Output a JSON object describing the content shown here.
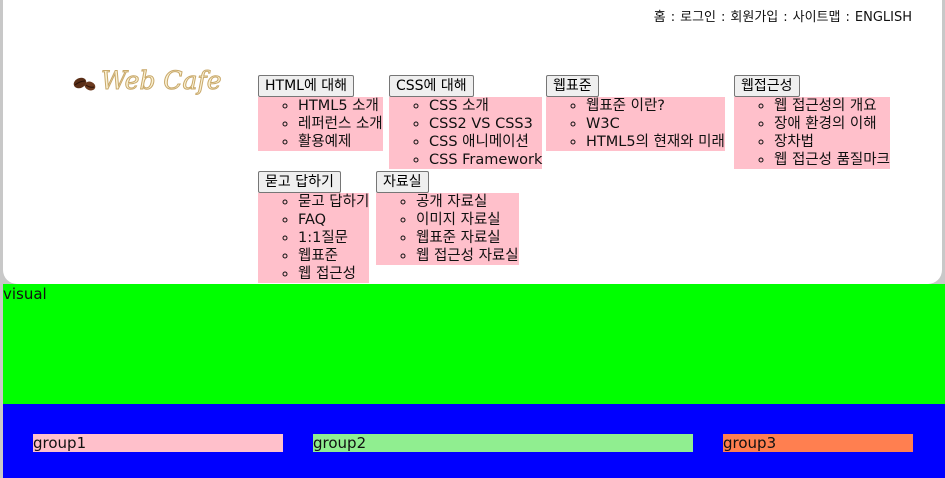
{
  "util_nav": {
    "items": [
      "홈",
      "로그인",
      "회원가입",
      "사이트맵",
      "ENGLISH"
    ],
    "separator": ":"
  },
  "logo": {
    "text": "Web Cafe",
    "icon": "coffee-beans-icon",
    "colors": {
      "bean": "#5a2e17",
      "text_fill": "#fbf2d4",
      "text_outline": "#c8a86a"
    }
  },
  "menus": [
    {
      "label": "HTML에 대해",
      "items": [
        "HTML5 소개",
        "레퍼런스 소개",
        "활용예제"
      ]
    },
    {
      "label": "CSS에 대해",
      "items": [
        "CSS 소개",
        "CSS2 VS CSS3",
        "CSS 애니메이션",
        "CSS Framework"
      ]
    },
    {
      "label": "웹표준",
      "items": [
        "웹표준 이란?",
        "W3C",
        "HTML5의 현재와 미래"
      ]
    },
    {
      "label": "웹접근성",
      "items": [
        "웹 접근성의 개요",
        "장애 환경의 이해",
        "장차법",
        "웹 접근성 품질마크"
      ]
    },
    {
      "label": "묻고 답하기",
      "items": [
        "묻고 답하기",
        "FAQ",
        "1:1질문",
        "웹표준",
        "웹 접근성"
      ]
    },
    {
      "label": "자료실",
      "items": [
        "공개 자료실",
        "이미지 자료실",
        "웹표준 자료실",
        "웹 접근성 자료실"
      ]
    }
  ],
  "visual": {
    "label": "visual",
    "color": "#00ff00"
  },
  "groups": {
    "background": "#0000ff",
    "items": [
      {
        "label": "group1",
        "color": "#ffc0cb"
      },
      {
        "label": "group2",
        "color": "#90ee90"
      },
      {
        "label": "group3",
        "color": "#ff7f50"
      }
    ]
  },
  "colors": {
    "submenu_bg": "#ffc0cb",
    "page_bg": "#c8c8c8",
    "header_bg": "#ffffff"
  }
}
